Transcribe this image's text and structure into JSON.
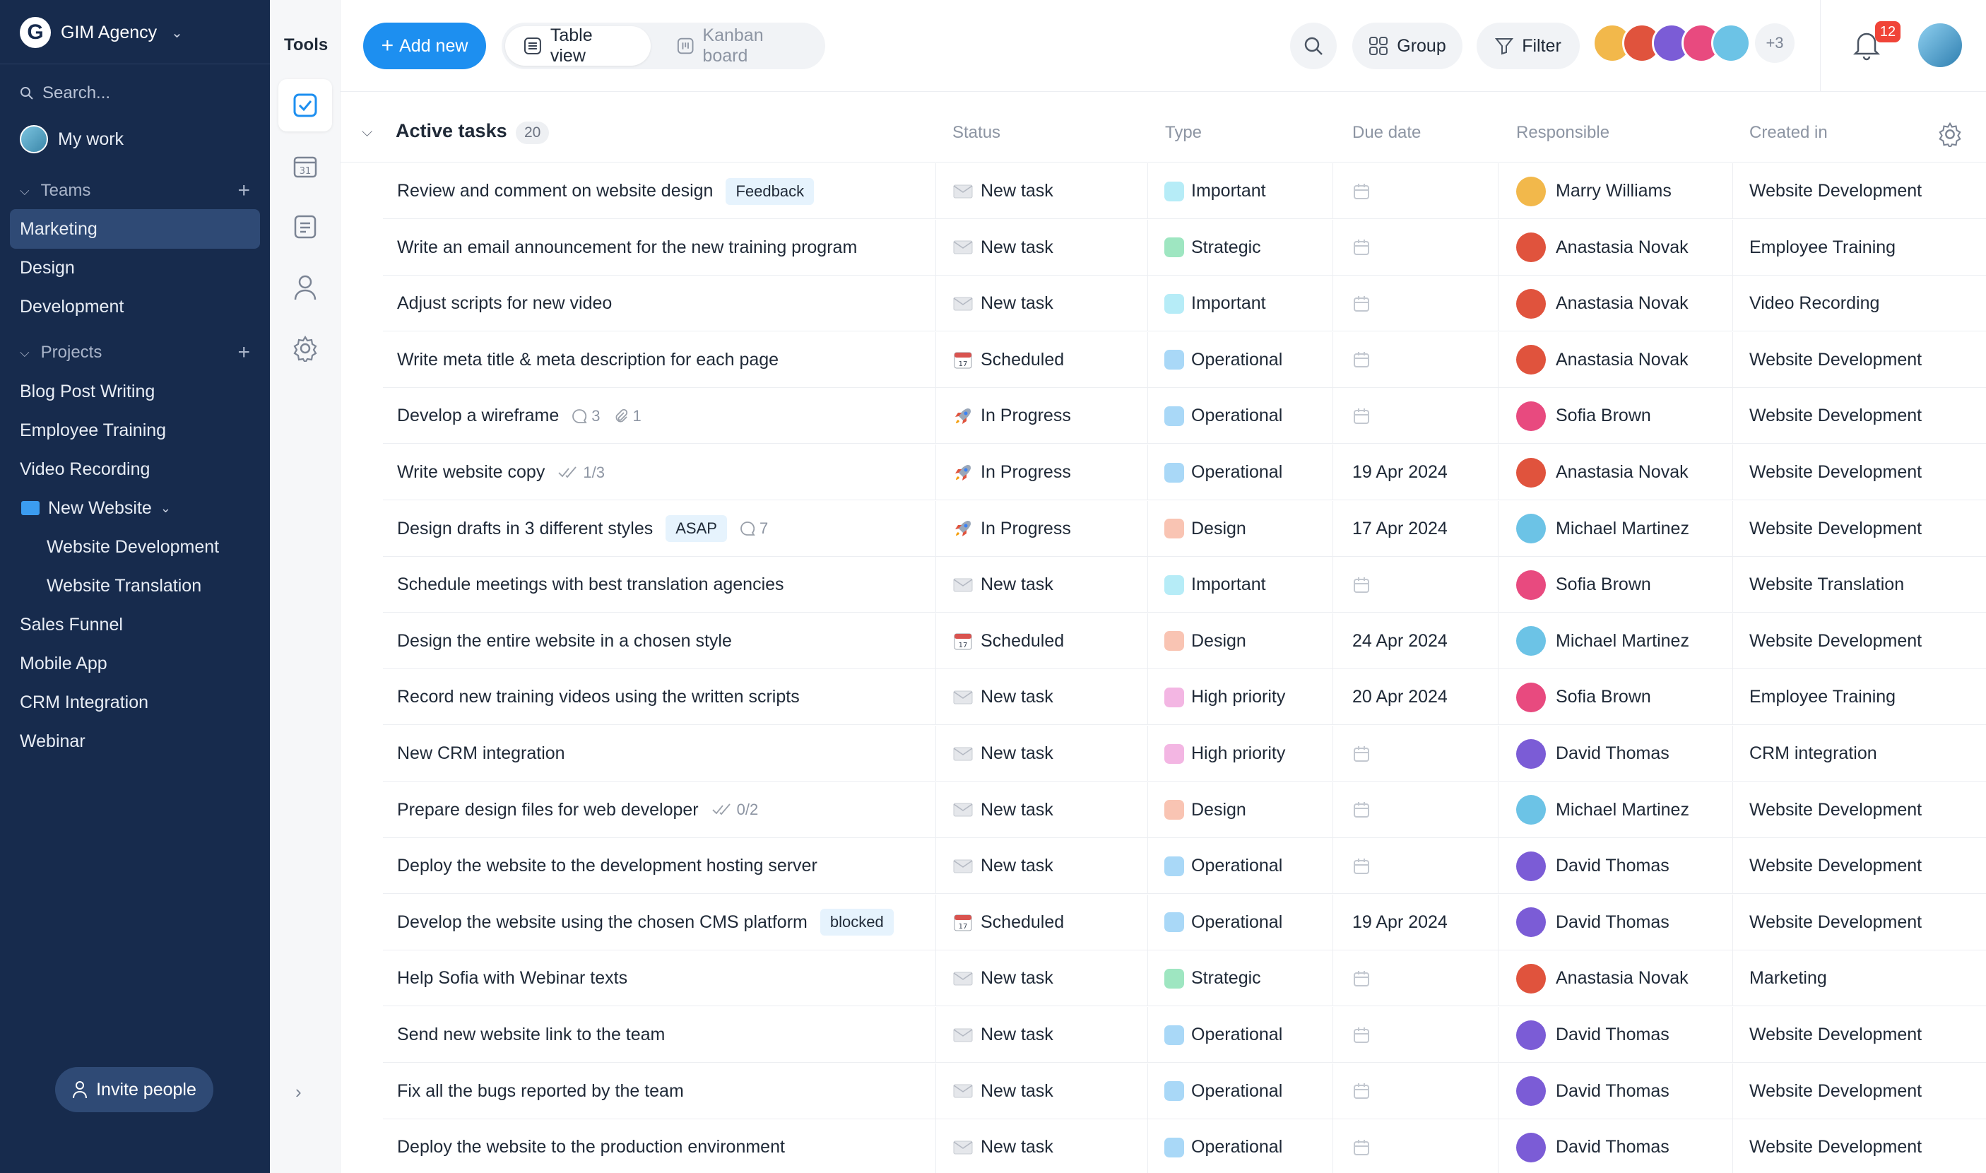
{
  "sidebar": {
    "org_logo": "G",
    "org_name": "GIM Agency",
    "search_placeholder": "Search...",
    "my_work": "My work",
    "teams_label": "Teams",
    "teams": [
      "Marketing",
      "Design",
      "Development"
    ],
    "projects_label": "Projects",
    "projects": [
      "Blog Post Writing",
      "Employee Training",
      "Video Recording"
    ],
    "folder": "New Website",
    "folder_items": [
      "Website Development",
      "Website Translation"
    ],
    "projects_more": [
      "Sales Funnel",
      "Mobile App",
      "CRM Integration",
      "Webinar"
    ],
    "invite": "Invite people"
  },
  "tools": {
    "title": "Tools"
  },
  "toolbar": {
    "add_new": "Add new",
    "table_view": "Table view",
    "kanban_board": "Kanban board",
    "group": "Group",
    "filter": "Filter",
    "more_avatars": "+3",
    "notifications": "12"
  },
  "section": {
    "title": "Active tasks",
    "count": "20"
  },
  "columns": {
    "status": "Status",
    "type": "Type",
    "due": "Due date",
    "responsible": "Responsible",
    "created": "Created in"
  },
  "colors": {
    "sidebar": "#172b4d",
    "accent": "#1d8ff0",
    "badge": "#f04438"
  },
  "tasks": [
    {
      "title": "Review and comment on website design",
      "tag": "Feedback",
      "tag_kind": "blue",
      "status": "New task",
      "status_icon": "envelope-icon",
      "type": "Important",
      "type_color": "#b6ecf7",
      "due": "",
      "resp": "Marry Williams",
      "resp_color": "#f2b84b",
      "created": "Website Development"
    },
    {
      "title": "Write an email announcement for the new training program",
      "status": "New task",
      "status_icon": "envelope-icon",
      "type": "Strategic",
      "type_color": "#9ee6c1",
      "due": "",
      "resp": "Anastasia Novak",
      "resp_color": "#e0533d",
      "created": "Employee Training"
    },
    {
      "title": "Adjust scripts for new video",
      "status": "New task",
      "status_icon": "envelope-icon",
      "type": "Important",
      "type_color": "#b6ecf7",
      "due": "",
      "resp": "Anastasia Novak",
      "resp_color": "#e0533d",
      "created": "Video Recording"
    },
    {
      "title": "Write meta title & meta description for each page",
      "status": "Scheduled",
      "status_icon": "calendar-icon",
      "type": "Operational",
      "type_color": "#a9d8f7",
      "due": "",
      "resp": "Anastasia Novak",
      "resp_color": "#e0533d",
      "created": "Website Development"
    },
    {
      "title": "Develop a wireframe",
      "comments": "3",
      "attachments": "1",
      "status": "In Progress",
      "status_icon": "rocket-icon",
      "type": "Operational",
      "type_color": "#a9d8f7",
      "due": "",
      "resp": "Sofia Brown",
      "resp_color": "#e84a7f",
      "created": "Website Development"
    },
    {
      "title": "Write website copy",
      "checklist": "1/3",
      "status": "In Progress",
      "status_icon": "rocket-icon",
      "type": "Operational",
      "type_color": "#a9d8f7",
      "due": "19 Apr 2024",
      "resp": "Anastasia Novak",
      "resp_color": "#e0533d",
      "created": "Website Development"
    },
    {
      "title": "Design drafts in 3 different styles",
      "tag": "ASAP",
      "tag_kind": "blue",
      "comments": "7",
      "status": "In Progress",
      "status_icon": "rocket-icon",
      "type": "Design",
      "type_color": "#f9c4b3",
      "due": "17 Apr 2024",
      "resp": "Michael Martinez",
      "resp_color": "#6cc3e6",
      "created": "Website Development"
    },
    {
      "title": "Schedule meetings with best translation agencies",
      "status": "New task",
      "status_icon": "envelope-icon",
      "type": "Important",
      "type_color": "#b6ecf7",
      "due": "",
      "resp": "Sofia Brown",
      "resp_color": "#e84a7f",
      "created": "Website Translation"
    },
    {
      "title": "Design the entire website in a chosen style",
      "status": "Scheduled",
      "status_icon": "calendar-icon",
      "type": "Design",
      "type_color": "#f9c4b3",
      "due": "24 Apr 2024",
      "resp": "Michael Martinez",
      "resp_color": "#6cc3e6",
      "created": "Website Development"
    },
    {
      "title": "Record new training videos using the written scripts",
      "status": "New task",
      "status_icon": "envelope-icon",
      "type": "High priority",
      "type_color": "#f3b6e3",
      "due": "20 Apr 2024",
      "resp": "Sofia Brown",
      "resp_color": "#e84a7f",
      "created": "Employee Training"
    },
    {
      "title": "New CRM integration",
      "status": "New task",
      "status_icon": "envelope-icon",
      "type": "High priority",
      "type_color": "#f3b6e3",
      "due": "",
      "resp": "David Thomas",
      "resp_color": "#7b5cd6",
      "created": "CRM integration"
    },
    {
      "title": "Prepare design files for web developer",
      "checklist": "0/2",
      "status": "New task",
      "status_icon": "envelope-icon",
      "type": "Design",
      "type_color": "#f9c4b3",
      "due": "",
      "resp": "Michael Martinez",
      "resp_color": "#6cc3e6",
      "created": "Website Development"
    },
    {
      "title": "Deploy the website to the development hosting server",
      "status": "New task",
      "status_icon": "envelope-icon",
      "type": "Operational",
      "type_color": "#a9d8f7",
      "due": "",
      "resp": "David Thomas",
      "resp_color": "#7b5cd6",
      "created": "Website Development"
    },
    {
      "title": "Develop the website using the chosen CMS platform",
      "tag": "blocked",
      "tag_kind": "blue",
      "status": "Scheduled",
      "status_icon": "calendar-icon",
      "type": "Operational",
      "type_color": "#a9d8f7",
      "due": "19 Apr 2024",
      "resp": "David Thomas",
      "resp_color": "#7b5cd6",
      "created": "Website Development"
    },
    {
      "title": "Help Sofia with Webinar texts",
      "status": "New task",
      "status_icon": "envelope-icon",
      "type": "Strategic",
      "type_color": "#9ee6c1",
      "due": "",
      "resp": "Anastasia Novak",
      "resp_color": "#e0533d",
      "created": "Marketing"
    },
    {
      "title": "Send new website link to the team",
      "status": "New task",
      "status_icon": "envelope-icon",
      "type": "Operational",
      "type_color": "#a9d8f7",
      "due": "",
      "resp": "David Thomas",
      "resp_color": "#7b5cd6",
      "created": "Website Development"
    },
    {
      "title": "Fix all the bugs reported by the team",
      "status": "New task",
      "status_icon": "envelope-icon",
      "type": "Operational",
      "type_color": "#a9d8f7",
      "due": "",
      "resp": "David Thomas",
      "resp_color": "#7b5cd6",
      "created": "Website Development"
    },
    {
      "title": "Deploy the website to the production environment",
      "status": "New task",
      "status_icon": "envelope-icon",
      "type": "Operational",
      "type_color": "#a9d8f7",
      "due": "",
      "resp": "David Thomas",
      "resp_color": "#7b5cd6",
      "created": "Website Development"
    }
  ]
}
